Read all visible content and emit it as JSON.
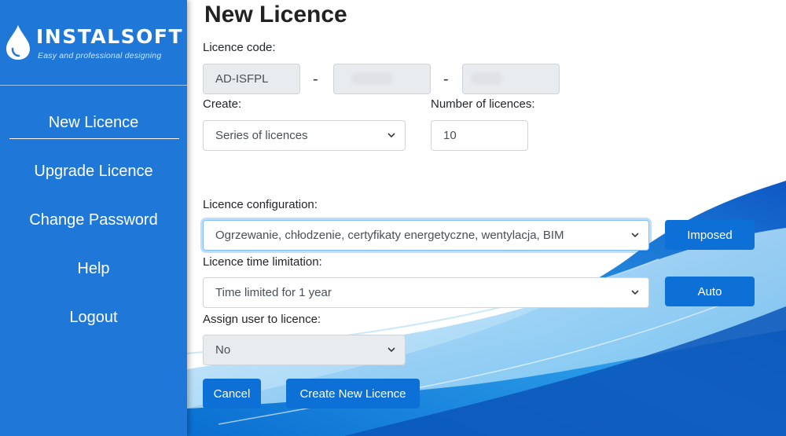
{
  "brand": {
    "name": "INSTALSOFT",
    "tagline": "Easy and professional designing"
  },
  "sidebar": {
    "items": [
      {
        "label": "New Licence",
        "active": true
      },
      {
        "label": "Upgrade Licence"
      },
      {
        "label": "Change Password"
      },
      {
        "label": "Help"
      },
      {
        "label": "Logout"
      }
    ]
  },
  "page": {
    "title": "New Licence"
  },
  "form": {
    "licence_code": {
      "label": "Licence code:",
      "prefix": "AD-ISFPL",
      "separator": "-"
    },
    "create": {
      "label": "Create:",
      "value": "Series of licences"
    },
    "number_of_licences": {
      "label": "Number of licences:",
      "value": "10"
    },
    "configuration": {
      "label": "Licence configuration:",
      "value": "Ogrzewanie, chłodzenie, certyfikaty energetyczne, wentylacja, BIM",
      "button": "Imposed"
    },
    "time_limitation": {
      "label": "Licence time limitation:",
      "value": "Time limited for 1 year",
      "button": "Auto"
    },
    "assign_user": {
      "label": "Assign user to licence:",
      "value": "No"
    }
  },
  "actions": {
    "cancel": "Cancel",
    "create": "Create New Licence"
  },
  "colors": {
    "sidebar": "#1f78d8",
    "button": "#0d70d7",
    "focus_border": "#80bdff"
  }
}
